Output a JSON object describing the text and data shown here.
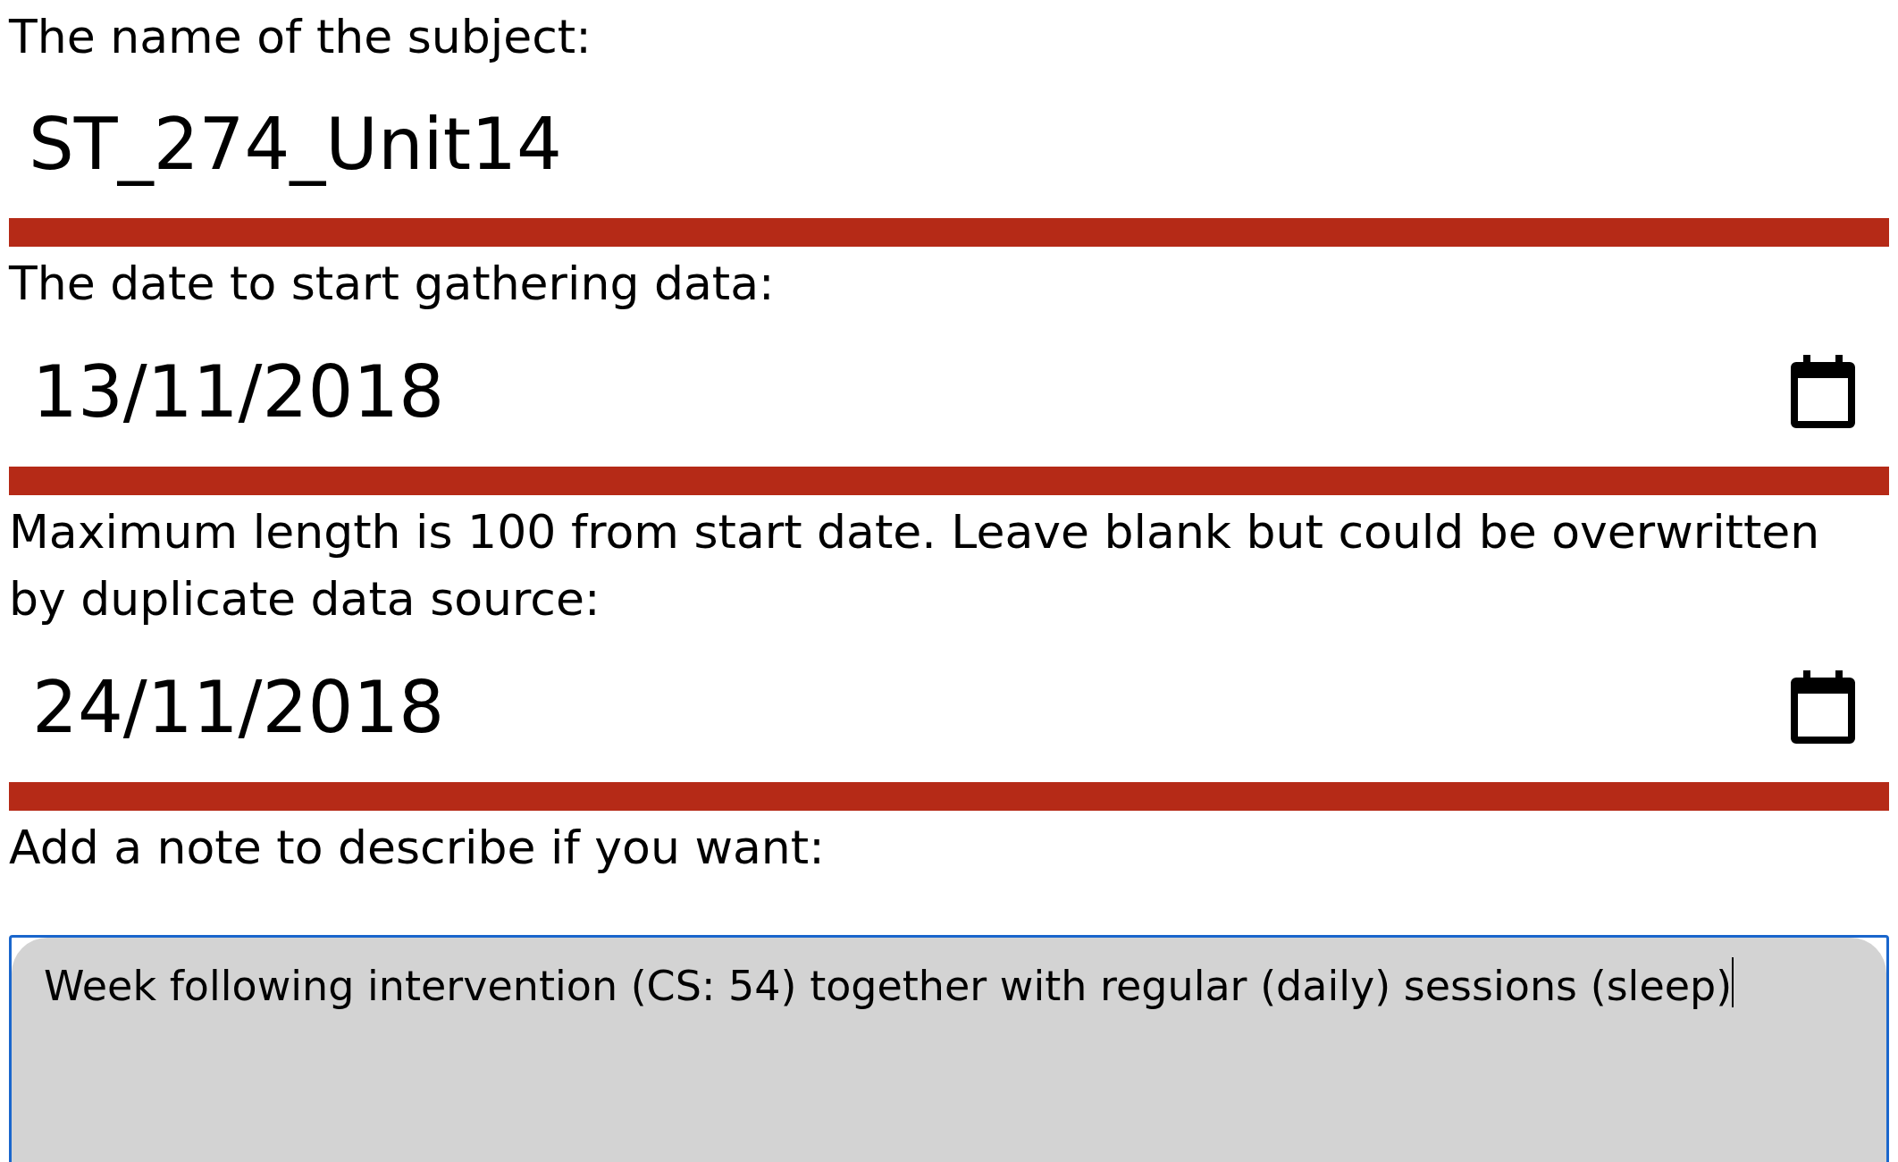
{
  "fields": [
    {
      "kind": "text",
      "label": "The name of the subject:",
      "value": "ST_274_Unit14"
    },
    {
      "kind": "date",
      "label": "The date to start gathering data:",
      "value": "13/11/2018"
    },
    {
      "kind": "date",
      "label": "Maximum length is 100 from start date. Leave blank but could be overwritten by duplicate data source:",
      "value": "24/11/2018"
    },
    {
      "kind": "note",
      "label": "Add a note to describe if you want:",
      "value": "Week following intervention (CS: 54) together with regular (daily) sessions (sleep)"
    }
  ]
}
